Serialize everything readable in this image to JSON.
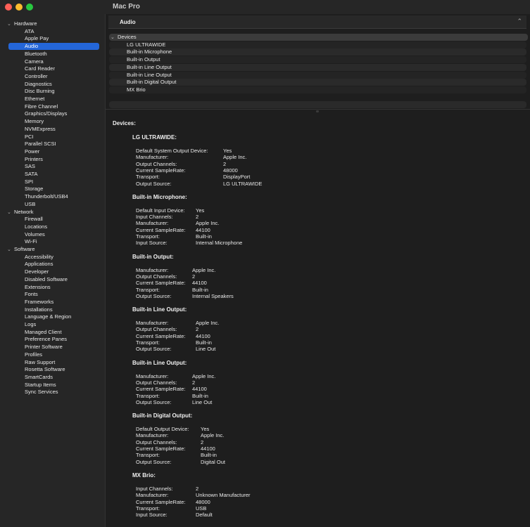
{
  "window": {
    "title": "Mac Pro"
  },
  "sidebar": {
    "categories": [
      {
        "label": "Hardware",
        "items": [
          "ATA",
          "Apple Pay",
          "Audio",
          "Bluetooth",
          "Camera",
          "Card Reader",
          "Controller",
          "Diagnostics",
          "Disc Burning",
          "Ethernet",
          "Fibre Channel",
          "Graphics/Displays",
          "Memory",
          "NVMExpress",
          "PCI",
          "Parallel SCSI",
          "Power",
          "Printers",
          "SAS",
          "SATA",
          "SPI",
          "Storage",
          "Thunderbolt/USB4",
          "USB"
        ]
      },
      {
        "label": "Network",
        "items": [
          "Firewall",
          "Locations",
          "Volumes",
          "Wi-Fi"
        ]
      },
      {
        "label": "Software",
        "items": [
          "Accessibility",
          "Applications",
          "Developer",
          "Disabled Software",
          "Extensions",
          "Fonts",
          "Frameworks",
          "Installations",
          "Language & Region",
          "Logs",
          "Managed Client",
          "Preference Panes",
          "Printer Software",
          "Profiles",
          "Raw Support",
          "Rosetta Software",
          "SmartCards",
          "Startup Items",
          "Sync Services"
        ]
      }
    ],
    "selected": "Audio"
  },
  "header": {
    "label": "Audio",
    "caret": "⌃"
  },
  "tree": {
    "root": "Devices",
    "children": [
      "LG ULTRAWIDE",
      "Built-in Microphone",
      "Built-in Output",
      "Built-in Line Output",
      "Built-in Line Output",
      "Built-in Digital Output",
      "MX Brio"
    ]
  },
  "detail": {
    "title": "Devices:",
    "devices": [
      {
        "name": "LG ULTRAWIDE:",
        "props": [
          [
            "Default System Output Device:",
            "Yes"
          ],
          [
            "Manufacturer:",
            "Apple Inc."
          ],
          [
            "Output Channels:",
            "2"
          ],
          [
            "Current SampleRate:",
            "48000"
          ],
          [
            "Transport:",
            "DisplayPort"
          ],
          [
            "Output Source:",
            "LG ULTRAWIDE"
          ]
        ]
      },
      {
        "name": "Built-in Microphone:",
        "props": [
          [
            "Default Input Device:",
            "Yes"
          ],
          [
            "Input Channels:",
            "2"
          ],
          [
            "Manufacturer:",
            "Apple Inc."
          ],
          [
            "Current SampleRate:",
            "44100"
          ],
          [
            "Transport:",
            "Built-in"
          ],
          [
            "Input Source:",
            "Internal Microphone"
          ]
        ]
      },
      {
        "name": "Built-in Output:",
        "props": [
          [
            "Manufacturer:",
            "Apple Inc."
          ],
          [
            "Output Channels:",
            "2"
          ],
          [
            "Current SampleRate:",
            "44100"
          ],
          [
            "Transport:",
            "Built-in"
          ],
          [
            "Output Source:",
            "Internal Speakers"
          ]
        ]
      },
      {
        "name": "Built-in Line Output:",
        "props": [
          [
            "Manufacturer:",
            "Apple Inc."
          ],
          [
            "Output Channels:",
            "2"
          ],
          [
            "Current SampleRate:",
            "44100"
          ],
          [
            "Transport:",
            "Built-in"
          ],
          [
            "Output Source:",
            "Line Out"
          ]
        ]
      },
      {
        "name": "Built-in Line Output:",
        "props": [
          [
            "Manufacturer:",
            "Apple Inc."
          ],
          [
            "Output Channels:",
            "2"
          ],
          [
            "Current SampleRate:",
            "44100"
          ],
          [
            "Transport:",
            "Built-in"
          ],
          [
            "Output Source:",
            "Line Out"
          ]
        ]
      },
      {
        "name": "Built-in Digital Output:",
        "props": [
          [
            "Default Output Device:",
            "Yes"
          ],
          [
            "Manufacturer:",
            "Apple Inc."
          ],
          [
            "Output Channels:",
            "2"
          ],
          [
            "Current SampleRate:",
            "44100"
          ],
          [
            "Transport:",
            "Built-in"
          ],
          [
            "Output Source:",
            "Digital Out"
          ]
        ]
      },
      {
        "name": "MX Brio:",
        "props": [
          [
            "Input Channels:",
            "2"
          ],
          [
            "Manufacturer:",
            "Unknown Manufacturer"
          ],
          [
            "Current SampleRate:",
            "48000"
          ],
          [
            "Transport:",
            "USB"
          ],
          [
            "Input Source:",
            "Default"
          ]
        ]
      }
    ]
  },
  "colors": {
    "accent": "#2466d8",
    "close": "#ff5f57",
    "minimize": "#febc2e",
    "maximize": "#28c840"
  }
}
